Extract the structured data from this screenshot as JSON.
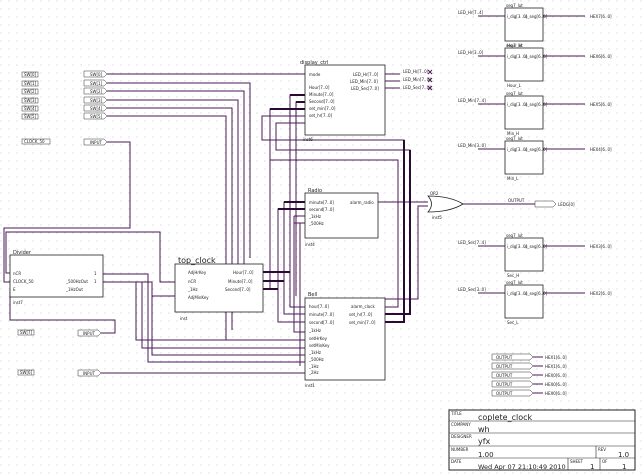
{
  "colors": {
    "wire": "#4a1a55",
    "bus": "#2a0a35",
    "box": "#222222",
    "text": "#222222",
    "grid": "#9aa3ad"
  },
  "inputs": [
    {
      "label": "SW[0]",
      "net": "SW[0]"
    },
    {
      "label": "SW[1]",
      "net": "SW[1]"
    },
    {
      "label": "SW[2]",
      "net": "SW[2]"
    },
    {
      "label": "SW[3]",
      "net": "SW[3]"
    },
    {
      "label": "SW[4]",
      "net": "SW[4]"
    },
    {
      "label": "SW[5]",
      "net": "SW[5]"
    }
  ],
  "clock_input": {
    "label": "CLOCK_50",
    "net": "INPUT"
  },
  "sw7_input": {
    "label": "SW[7]",
    "net": "INPUT"
  },
  "sw6_input": {
    "label": "SW[6]",
    "net": "INPUT"
  },
  "divider": {
    "name": "Divider",
    "ports_in": [
      "nCR",
      "CLOCK_50",
      "E"
    ],
    "ports_out": [
      "_500HzOut",
      "_1HzOut"
    ],
    "inst": "inst7",
    "right_ports": [
      "1",
      "1"
    ]
  },
  "top_clock": {
    "name": "top_clock",
    "ports_in": [
      "AdjHrKey",
      "nCR",
      "_1Hz",
      "AdjMinKey"
    ],
    "ports_out": [
      "Hour[7..0]",
      "Minute[7..0]",
      "Second[7..0]"
    ],
    "inst": "inst"
  },
  "display": {
    "name": "display_ctrl",
    "ports_in": [
      "mode",
      "Hour[7..0]",
      "Minute[7..0]",
      "Second[7..0]",
      "set_min[7..0]",
      "set_hr[7..0]"
    ],
    "ports_out": [
      "LED_Hr[7..0]",
      "LED_Min[7..0]",
      "LED_Sec[7..0]"
    ],
    "inst": "inst6"
  },
  "radio": {
    "name": "Radio",
    "ports_in": [
      "minute[7..0]",
      "second[7..0]",
      "_1kHz",
      "_500Hz"
    ],
    "ports_out": [
      "alarm_radio"
    ],
    "inst": "inst4"
  },
  "bell": {
    "name": "Bell",
    "ports_in": [
      "hour[7..0]",
      "minute[7..0]",
      "second[7..0]",
      "_1kHz",
      "setHrKey",
      "setMinKey",
      "_1kHz",
      "_500Hz",
      "_1Hz",
      "_2Hz",
      "ctrlBell"
    ],
    "ports_out": [
      "alarm_clock",
      "set_hr[7..0]",
      "set_min[7..0]"
    ],
    "inst": "inst1"
  },
  "or_gate": {
    "name": "OR2",
    "inst": "inst5"
  },
  "ledg_output": {
    "net": "OUTPUT",
    "label": "LEDG[0]"
  },
  "display_outputs": [
    "LED_Hr[7..0]",
    "LED_Min[7..0]",
    "LED_Sec[7..0]"
  ],
  "seg_blocks": [
    {
      "title": "seg7_lut",
      "in": "LED_Hr[7..4]",
      "port_in": "i_dig[3..0]",
      "port_out": "o_seg[6..0]",
      "out": "HEX7[6..0]",
      "inst": "Hour_H"
    },
    {
      "title": "seg7_lut",
      "in": "LED_Hr[3..0]",
      "port_in": "i_dig[3..0]",
      "port_out": "o_seg[6..0]",
      "out": "HEX6[6..0]",
      "inst": "Hour_L"
    },
    {
      "title": "seg7_lut",
      "in": "LED_Min[7..4]",
      "port_in": "i_dig[3..0]",
      "port_out": "o_seg[6..0]",
      "out": "HEX5[6..0]",
      "inst": "Min_H"
    },
    {
      "title": "seg7_lut",
      "in": "LED_Min[3..0]",
      "port_in": "i_dig[3..0]",
      "port_out": "o_seg[6..0]",
      "out": "HEX4[6..0]",
      "inst": "Min_L"
    },
    {
      "title": "seg7_lut",
      "in": "LED_Sec[7..4]",
      "port_in": "i_dig[3..0]",
      "port_out": "o_seg[6..0]",
      "out": "HEX3[6..0]",
      "inst": "Sec_H"
    },
    {
      "title": "seg7_lut",
      "in": "LED_Sec[3..0]",
      "port_in": "i_dig[3..0]",
      "port_out": "o_seg[6..0]",
      "out": "HEX2[6..0]",
      "inst": "Sec_L"
    }
  ],
  "hex_outputs": [
    {
      "net": "OUTPUT",
      "label": "HEX1[6..0]"
    },
    {
      "net": "OUTPUT",
      "label": "HEX1[6..0]"
    },
    {
      "net": "OUTPUT",
      "label": "HEX0[6..0]"
    },
    {
      "net": "OUTPUT",
      "label": "HEX0[6..0]"
    }
  ],
  "title_block": {
    "title_label": "TITLE",
    "title": "coplete_clock",
    "company_label": "COMPANY",
    "company": "wh",
    "designer_label": "DESIGNER",
    "designer": "yfx",
    "number_label": "NUMBER",
    "number": "1.00",
    "rev_label": "REV",
    "rev": "1.0",
    "date_label": "DATE",
    "date": "Wed Apr 07 21:10:49 2010",
    "sheet_label": "SHEET",
    "sheet": "1",
    "of_label": "OF",
    "of": "1"
  }
}
